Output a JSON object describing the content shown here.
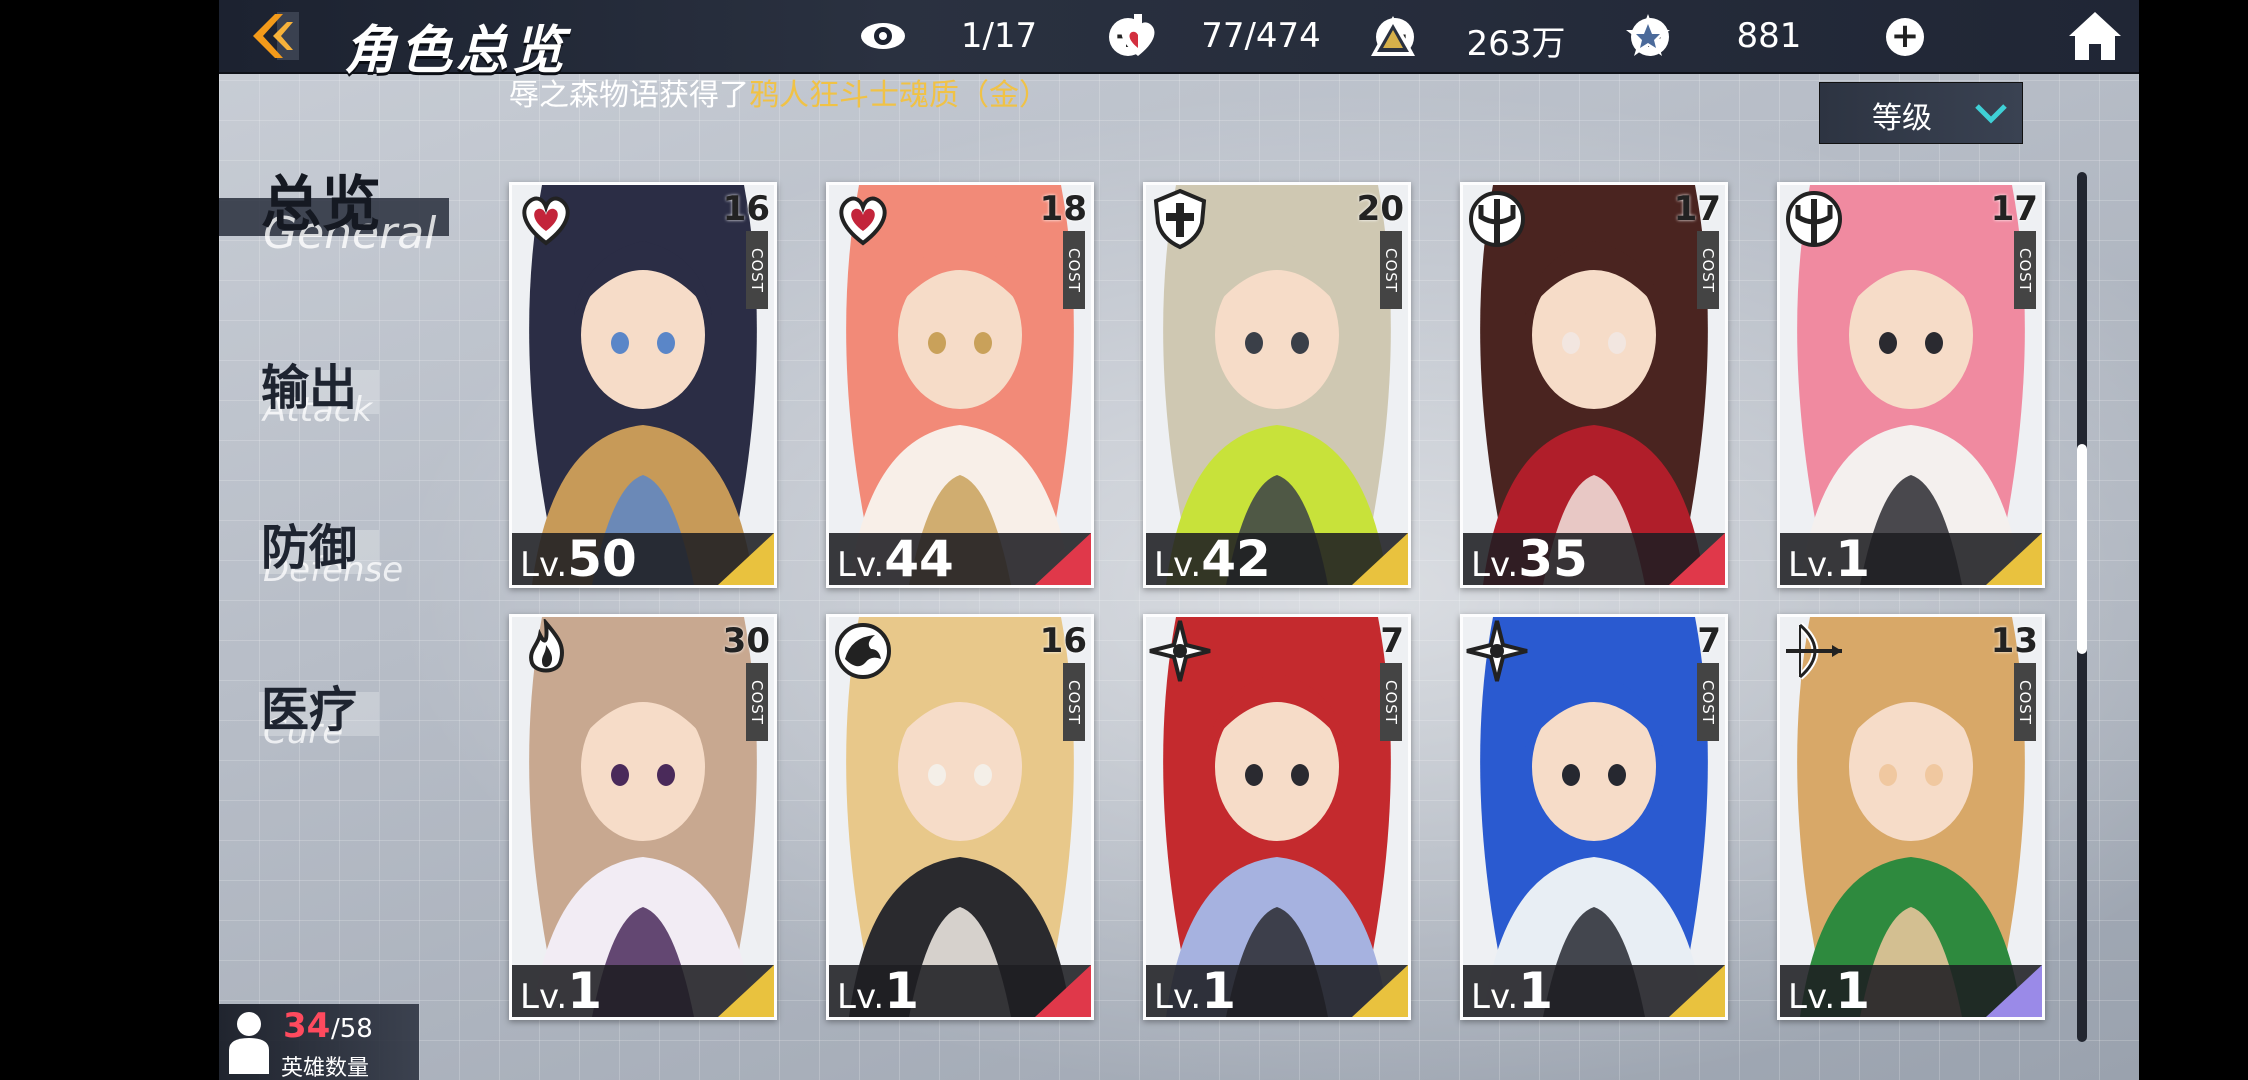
{
  "topbar": {
    "title": "角色总览",
    "resources": [
      {
        "icon": "eye-icon",
        "value": "1/17"
      },
      {
        "icon": "heart-potion-icon",
        "value": "77/474"
      },
      {
        "icon": "gold-pyramid-icon",
        "value": "263万"
      },
      {
        "icon": "star-crystal-icon",
        "value": "881"
      }
    ]
  },
  "ticker": {
    "prefix": "辱之森物语获得了",
    "highlight": "鸦人狂斗士魂质（金）"
  },
  "sort": {
    "label": "等级"
  },
  "tabs": [
    {
      "zh": "总览",
      "en": "General"
    },
    {
      "zh": "输出",
      "en": "Attack"
    },
    {
      "zh": "防御",
      "en": "Defense"
    },
    {
      "zh": "医疗",
      "en": "Cure"
    }
  ],
  "cost_label": "COST",
  "level_prefix": "Lv.",
  "cards": [
    {
      "class_icon": "heart-class-icon",
      "cost": "16",
      "level": "50",
      "accent": "#e9c23e",
      "art": [
        "#2b2d45",
        "#c79a58",
        "#5a86c8"
      ]
    },
    {
      "class_icon": "heart-class-icon",
      "cost": "18",
      "level": "44",
      "accent": "#e0384a",
      "art": [
        "#f28a78",
        "#f8efe8",
        "#c9a15a"
      ]
    },
    {
      "class_icon": "shield-class-icon",
      "cost": "20",
      "level": "42",
      "accent": "#e9c23e",
      "art": [
        "#cfc8b2",
        "#c8e23a",
        "#3a3f48"
      ]
    },
    {
      "class_icon": "trident-class-icon",
      "cost": "17",
      "level": "35",
      "accent": "#e0384a",
      "art": [
        "#4a2420",
        "#b01e2a",
        "#f2e6e0"
      ]
    },
    {
      "class_icon": "trident-class-icon",
      "cost": "17",
      "level": "1",
      "accent": "#e9c23e",
      "art": [
        "#f08aa0",
        "#f4f0ee",
        "#2a2a30"
      ]
    },
    {
      "class_icon": "flame-class-icon",
      "cost": "30",
      "level": "1",
      "accent": "#e9c23e",
      "art": [
        "#c8a890",
        "#f2ecf4",
        "#4a2a5a"
      ]
    },
    {
      "class_icon": "dragon-class-icon",
      "cost": "16",
      "level": "1",
      "accent": "#e0384a",
      "art": [
        "#e8c88a",
        "#2a2a2e",
        "#f4efe8"
      ]
    },
    {
      "class_icon": "shuriken-class-icon",
      "cost": "7",
      "level": "1",
      "accent": "#e9c23e",
      "art": [
        "#c42a2e",
        "#a6b2e0",
        "#2a2a30"
      ]
    },
    {
      "class_icon": "shuriken-class-icon",
      "cost": "7",
      "level": "1",
      "accent": "#e9c23e",
      "art": [
        "#2a5ad0",
        "#e8eef4",
        "#262830"
      ]
    },
    {
      "class_icon": "bow-class-icon",
      "cost": "13",
      "level": "1",
      "accent": "#9a8ae8",
      "art": [
        "#d8a868",
        "#2e8a3e",
        "#f0c8a0"
      ]
    }
  ],
  "hero_count": {
    "current": "34",
    "max": "/58",
    "label": "英雄数量"
  },
  "colors": {
    "gold": "#f0c246",
    "red": "#ff4a5e",
    "topbar": "#1c2230"
  }
}
